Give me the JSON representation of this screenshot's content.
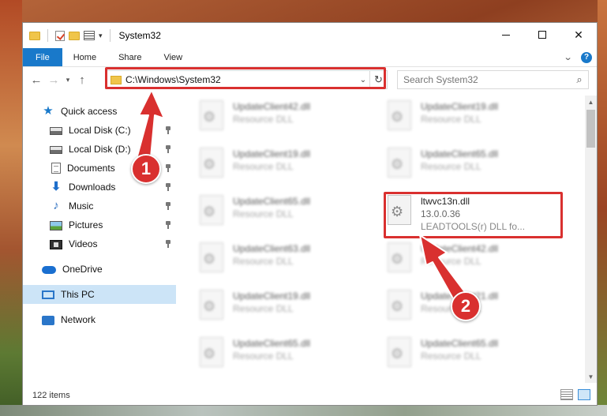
{
  "window": {
    "title": "System32"
  },
  "ribbon": {
    "tabs": [
      "File",
      "Home",
      "Share",
      "View"
    ],
    "help_symbol": "?"
  },
  "address": {
    "path": "C:\\Windows\\System32"
  },
  "search": {
    "placeholder": "Search System32"
  },
  "sidebar": {
    "quick_access": "Quick access",
    "items": [
      {
        "label": "Local Disk (C:)",
        "icon": "drive-icon",
        "pinned": true
      },
      {
        "label": "Local Disk (D:)",
        "icon": "drive-icon",
        "pinned": true
      },
      {
        "label": "Documents",
        "icon": "documents-icon",
        "pinned": true
      },
      {
        "label": "Downloads",
        "icon": "downloads-icon",
        "pinned": true
      },
      {
        "label": "Music",
        "icon": "music-icon",
        "pinned": true
      },
      {
        "label": "Pictures",
        "icon": "pictures-icon",
        "pinned": true
      },
      {
        "label": "Videos",
        "icon": "videos-icon",
        "pinned": true
      }
    ],
    "onedrive": "OneDrive",
    "this_pc": "This PC",
    "network": "Network"
  },
  "files": [
    {
      "name": "UpdateClient42.dll",
      "desc": "Resource DLL",
      "blurred": true
    },
    {
      "name": "UpdateClient19.dll",
      "desc": "Resource DLL",
      "blurred": true
    },
    {
      "name": "UpdateClient19.dll",
      "desc": "Resource DLL",
      "blurred": true
    },
    {
      "name": "UpdateClient65.dll",
      "desc": "Resource DLL",
      "blurred": true
    },
    {
      "name": "UpdateClient65.dll",
      "desc": "Resource DLL",
      "blurred": true
    },
    {
      "name": "ltwvc13n.dll",
      "version": "13.0.0.36",
      "desc": "LEADTOOLS(r) DLL fo...",
      "blurred": false
    },
    {
      "name": "UpdateClient63.dll",
      "desc": "Resource DLL",
      "blurred": true
    },
    {
      "name": "UpdateClient42.dll",
      "desc": "Resource DLL",
      "blurred": true
    },
    {
      "name": "UpdateClient19.dll",
      "desc": "Resource DLL",
      "blurred": true
    },
    {
      "name": "UpdateClient21.dll",
      "desc": "Resource DLL",
      "blurred": true
    },
    {
      "name": "UpdateClient65.dll",
      "desc": "Resource DLL",
      "blurred": true
    },
    {
      "name": "UpdateClient65.dll",
      "desc": "Resource DLL",
      "blurred": true
    }
  ],
  "status": {
    "item_count": "122 items"
  },
  "annotations": {
    "badge1": "1",
    "badge2": "2",
    "color": "#d9302f"
  }
}
